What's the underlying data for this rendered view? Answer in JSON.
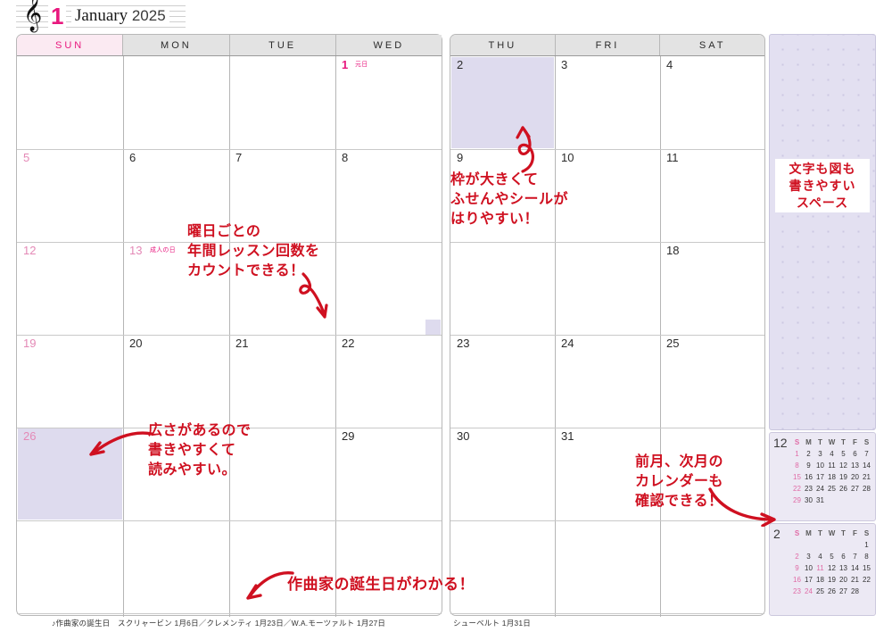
{
  "header": {
    "clef_icon": "treble-clef-icon",
    "month_number": "1",
    "month_name": "January",
    "year": "2025"
  },
  "left_page": {
    "weekdays": [
      "SUN",
      "MON",
      "TUE",
      "WED"
    ],
    "days": [
      {
        "n": "1",
        "col": 3,
        "row": 0,
        "style": "red",
        "holiday": "元日"
      },
      {
        "n": "5",
        "col": 0,
        "row": 1,
        "style": "sun"
      },
      {
        "n": "6",
        "col": 1,
        "row": 1,
        "style": "norm"
      },
      {
        "n": "7",
        "col": 2,
        "row": 1,
        "style": "norm"
      },
      {
        "n": "8",
        "col": 3,
        "row": 1,
        "style": "norm"
      },
      {
        "n": "12",
        "col": 0,
        "row": 2,
        "style": "sun"
      },
      {
        "n": "13",
        "col": 1,
        "row": 2,
        "style": "hol",
        "holiday": "成人の日"
      },
      {
        "n": "19",
        "col": 0,
        "row": 3,
        "style": "sun"
      },
      {
        "n": "20",
        "col": 1,
        "row": 3,
        "style": "norm"
      },
      {
        "n": "21",
        "col": 2,
        "row": 3,
        "style": "norm"
      },
      {
        "n": "22",
        "col": 3,
        "row": 3,
        "style": "norm"
      },
      {
        "n": "26",
        "col": 0,
        "row": 4,
        "style": "sun"
      },
      {
        "n": "29",
        "col": 3,
        "row": 4,
        "style": "norm"
      }
    ],
    "footer": "♪作曲家の誕生日　スクリャービン 1月6日／クレメンティ 1月23日／W.A.モーツァルト 1月27日"
  },
  "right_page": {
    "weekdays": [
      "THU",
      "FRI",
      "SAT"
    ],
    "days": [
      {
        "n": "2",
        "col": 0,
        "row": 0,
        "style": "norm"
      },
      {
        "n": "3",
        "col": 1,
        "row": 0,
        "style": "norm"
      },
      {
        "n": "4",
        "col": 2,
        "row": 0,
        "style": "norm"
      },
      {
        "n": "9",
        "col": 0,
        "row": 1,
        "style": "norm"
      },
      {
        "n": "10",
        "col": 1,
        "row": 1,
        "style": "norm"
      },
      {
        "n": "11",
        "col": 2,
        "row": 1,
        "style": "norm"
      },
      {
        "n": "18",
        "col": 2,
        "row": 2,
        "style": "norm"
      },
      {
        "n": "23",
        "col": 0,
        "row": 3,
        "style": "norm"
      },
      {
        "n": "24",
        "col": 1,
        "row": 3,
        "style": "norm"
      },
      {
        "n": "25",
        "col": 2,
        "row": 3,
        "style": "norm"
      },
      {
        "n": "30",
        "col": 0,
        "row": 4,
        "style": "norm"
      },
      {
        "n": "31",
        "col": 1,
        "row": 4,
        "style": "norm"
      }
    ],
    "footer": "シューベルト 1月31日"
  },
  "notes_panel": {
    "label_line1": "文字も図も",
    "label_line2": "書きやすい",
    "label_line3": "スペース"
  },
  "mini_calendars": [
    {
      "month": "12",
      "headers": [
        "S",
        "M",
        "T",
        "W",
        "T",
        "F",
        "S"
      ],
      "weeks": [
        [
          "1",
          "2",
          "3",
          "4",
          "5",
          "6",
          "7"
        ],
        [
          "8",
          "9",
          "10",
          "11",
          "12",
          "13",
          "14"
        ],
        [
          "15",
          "16",
          "17",
          "18",
          "19",
          "20",
          "21"
        ],
        [
          "22",
          "23",
          "24",
          "25",
          "26",
          "27",
          "28"
        ],
        [
          "29",
          "30",
          "31",
          "",
          "",
          "",
          ""
        ]
      ],
      "accent_days": [
        "1",
        "8",
        "15",
        "22",
        "29"
      ]
    },
    {
      "month": "2",
      "headers": [
        "S",
        "M",
        "T",
        "W",
        "T",
        "F",
        "S"
      ],
      "weeks": [
        [
          "",
          "",
          "",
          "",
          "",
          "",
          "1"
        ],
        [
          "2",
          "3",
          "4",
          "5",
          "6",
          "7",
          "8"
        ],
        [
          "9",
          "10",
          "11",
          "12",
          "13",
          "14",
          "15"
        ],
        [
          "16",
          "17",
          "18",
          "19",
          "20",
          "21",
          "22"
        ],
        [
          "23",
          "24",
          "25",
          "26",
          "27",
          "28",
          ""
        ]
      ],
      "accent_days": [
        "2",
        "9",
        "11",
        "16",
        "23",
        "24"
      ]
    }
  ],
  "annotations": {
    "weekday_count": "曜日ごとの\n年間レッスン回数を\nカウントできる！",
    "big_frame": "枠が大きくて\nふせんやシールが\nはりやすい！",
    "wide_space": "広さがあるので\n書きやすくて\n読みやすい。",
    "composer_birthday": "作曲家の誕生日がわかる！",
    "prev_next_calendar": "前月、次月の\nカレンダーも\n確認できる！"
  },
  "colors": {
    "accent_pink": "#e8187e",
    "anno_red": "#cf1020",
    "highlight_lavender": "#dedbee",
    "header_gray": "#e3e3e3",
    "sunday_pink_bg": "#fbeaf2"
  }
}
